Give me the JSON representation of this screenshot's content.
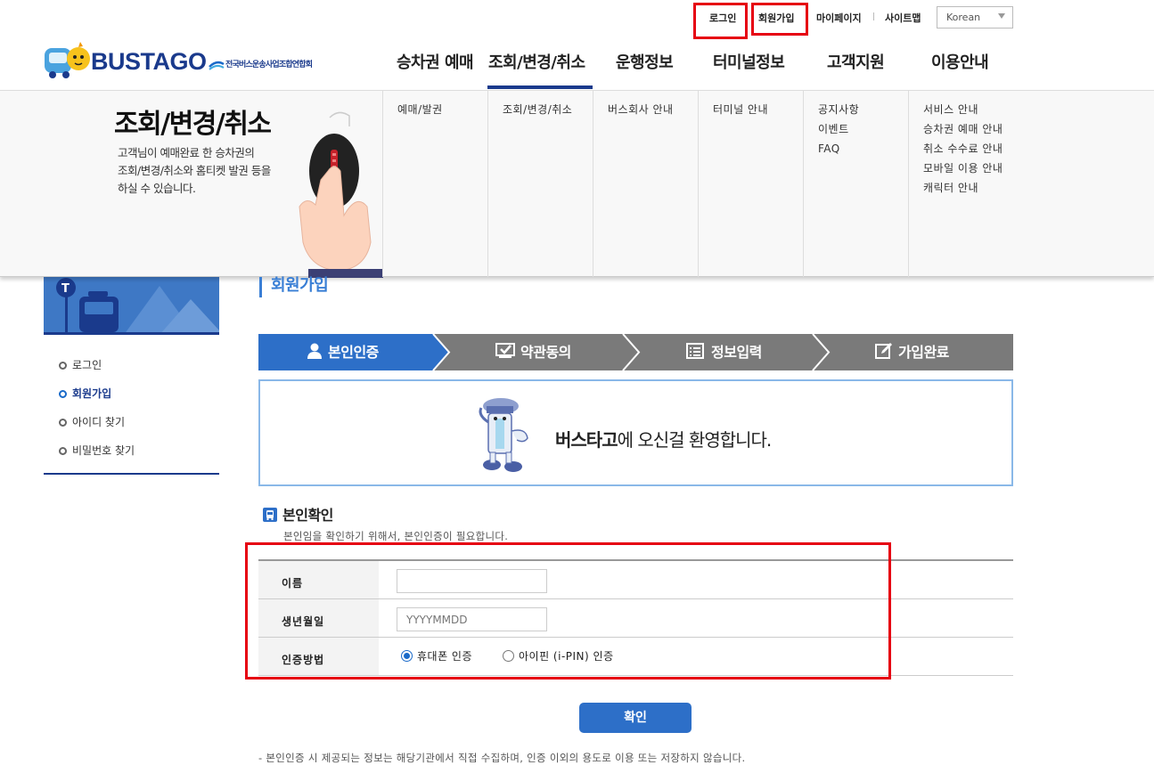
{
  "util": {
    "login": "로그인",
    "join": "회원가입",
    "mypage": "마이페이지",
    "sitemap": "사이트맵",
    "language": "Korean"
  },
  "brand": {
    "logo_text": "BUSTAGO",
    "association": "전국버스운송사업조합연합회"
  },
  "gnb": [
    "승차권 예매",
    "조회/변경/취소",
    "운행정보",
    "터미널정보",
    "고객지원",
    "이용안내"
  ],
  "mega": {
    "title": "조회/변경/취소",
    "desc": [
      "고객님이 예매완료 한 승차권의",
      "조회/변경/취소와 홈티켓 발권 등을",
      "하실 수 있습니다."
    ],
    "columns": [
      [
        "예매/발권"
      ],
      [
        "조회/변경/취소"
      ],
      [
        "버스회사 안내"
      ],
      [
        "터미널 안내"
      ],
      [
        "공지사항",
        "이벤트",
        "FAQ"
      ],
      [
        "서비스 안내",
        "승차권 예매 안내",
        "취소 수수료 안내",
        "모바일 이용 안내",
        "캐릭터 안내"
      ]
    ]
  },
  "sidebar": {
    "items": [
      "로그인",
      "회원가입",
      "아이디 찾기",
      "비밀번호 찾기"
    ],
    "active_index": 1
  },
  "page_title": "회원가입",
  "steps": [
    "본인인증",
    "약관동의",
    "정보입력",
    "가입완료"
  ],
  "active_step": 0,
  "welcome": {
    "brand": "버스타고",
    "rest": "에 오신걸 환영합니다."
  },
  "verify": {
    "title": "본인확인",
    "desc": "본인임을 확인하기 위해서, 본인인증이 필요합니다.",
    "name_label": "이름",
    "name_value": "",
    "birth_label": "생년월일",
    "birth_placeholder": "YYYYMMDD",
    "method_label": "인증방법",
    "method_options": [
      "휴대폰 인증",
      "아이핀 (i-PIN) 인증"
    ],
    "method_selected": 0,
    "confirm_label": "확인"
  },
  "note": "- 본인인증 시 제공되는 정보는 해당기관에서 직접 수집하며, 인증 이외의 용도로 이용 또는 저장하지 않습니다.",
  "colors": {
    "brand_navy": "#1a3a8c",
    "step_active": "#2d6fc8",
    "step_inactive": "#7a7a7a",
    "highlight_red": "#e60012"
  }
}
